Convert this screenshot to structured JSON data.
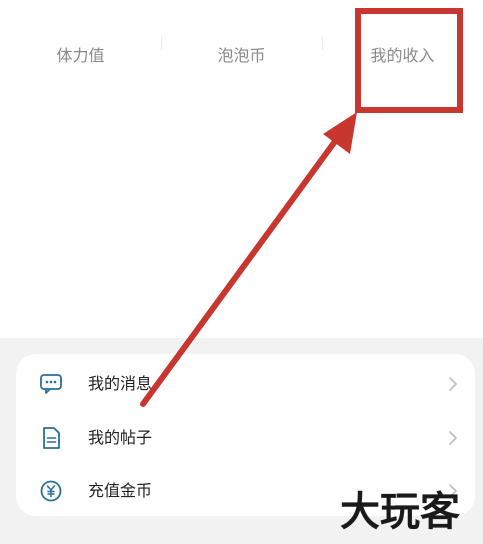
{
  "stats": [
    "体力值",
    "泡泡币",
    "我的收入"
  ],
  "menu": {
    "items": [
      {
        "label": "我的消息",
        "icon": "message-icon"
      },
      {
        "label": "我的帖子",
        "icon": "document-icon"
      },
      {
        "label": "充值金币",
        "icon": "coin-icon"
      }
    ]
  },
  "watermark": "大玩客",
  "colors": {
    "annotation": "#c8372f",
    "icon": "#2a6f97",
    "background_gray": "#f2f2f2"
  }
}
